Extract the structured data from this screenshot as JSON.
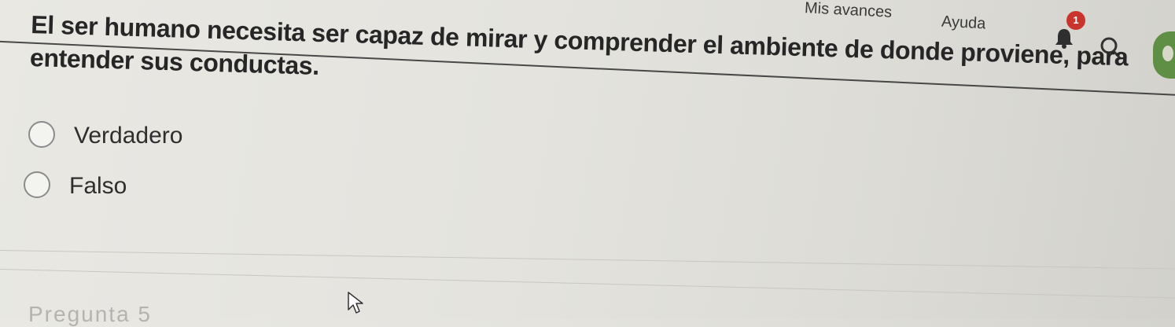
{
  "header": {
    "nav": {
      "progress_label": "Mis avances",
      "help_label": "Ayuda"
    },
    "notifications": {
      "count": "1",
      "icon": "bell-icon"
    },
    "search": {
      "icon": "search-icon"
    },
    "avatar": {
      "color": "#5f8f44"
    }
  },
  "question": {
    "text": "El ser humano necesita ser capaz de mirar y comprender el ambiente de donde proviene, para entender sus conductas.",
    "options": [
      {
        "label": "Verdadero",
        "selected": false
      },
      {
        "label": "Falso",
        "selected": false
      }
    ]
  },
  "next_question": {
    "label": "Pregunta 5"
  },
  "colors": {
    "badge": "#c9352d",
    "text": "#262626"
  }
}
